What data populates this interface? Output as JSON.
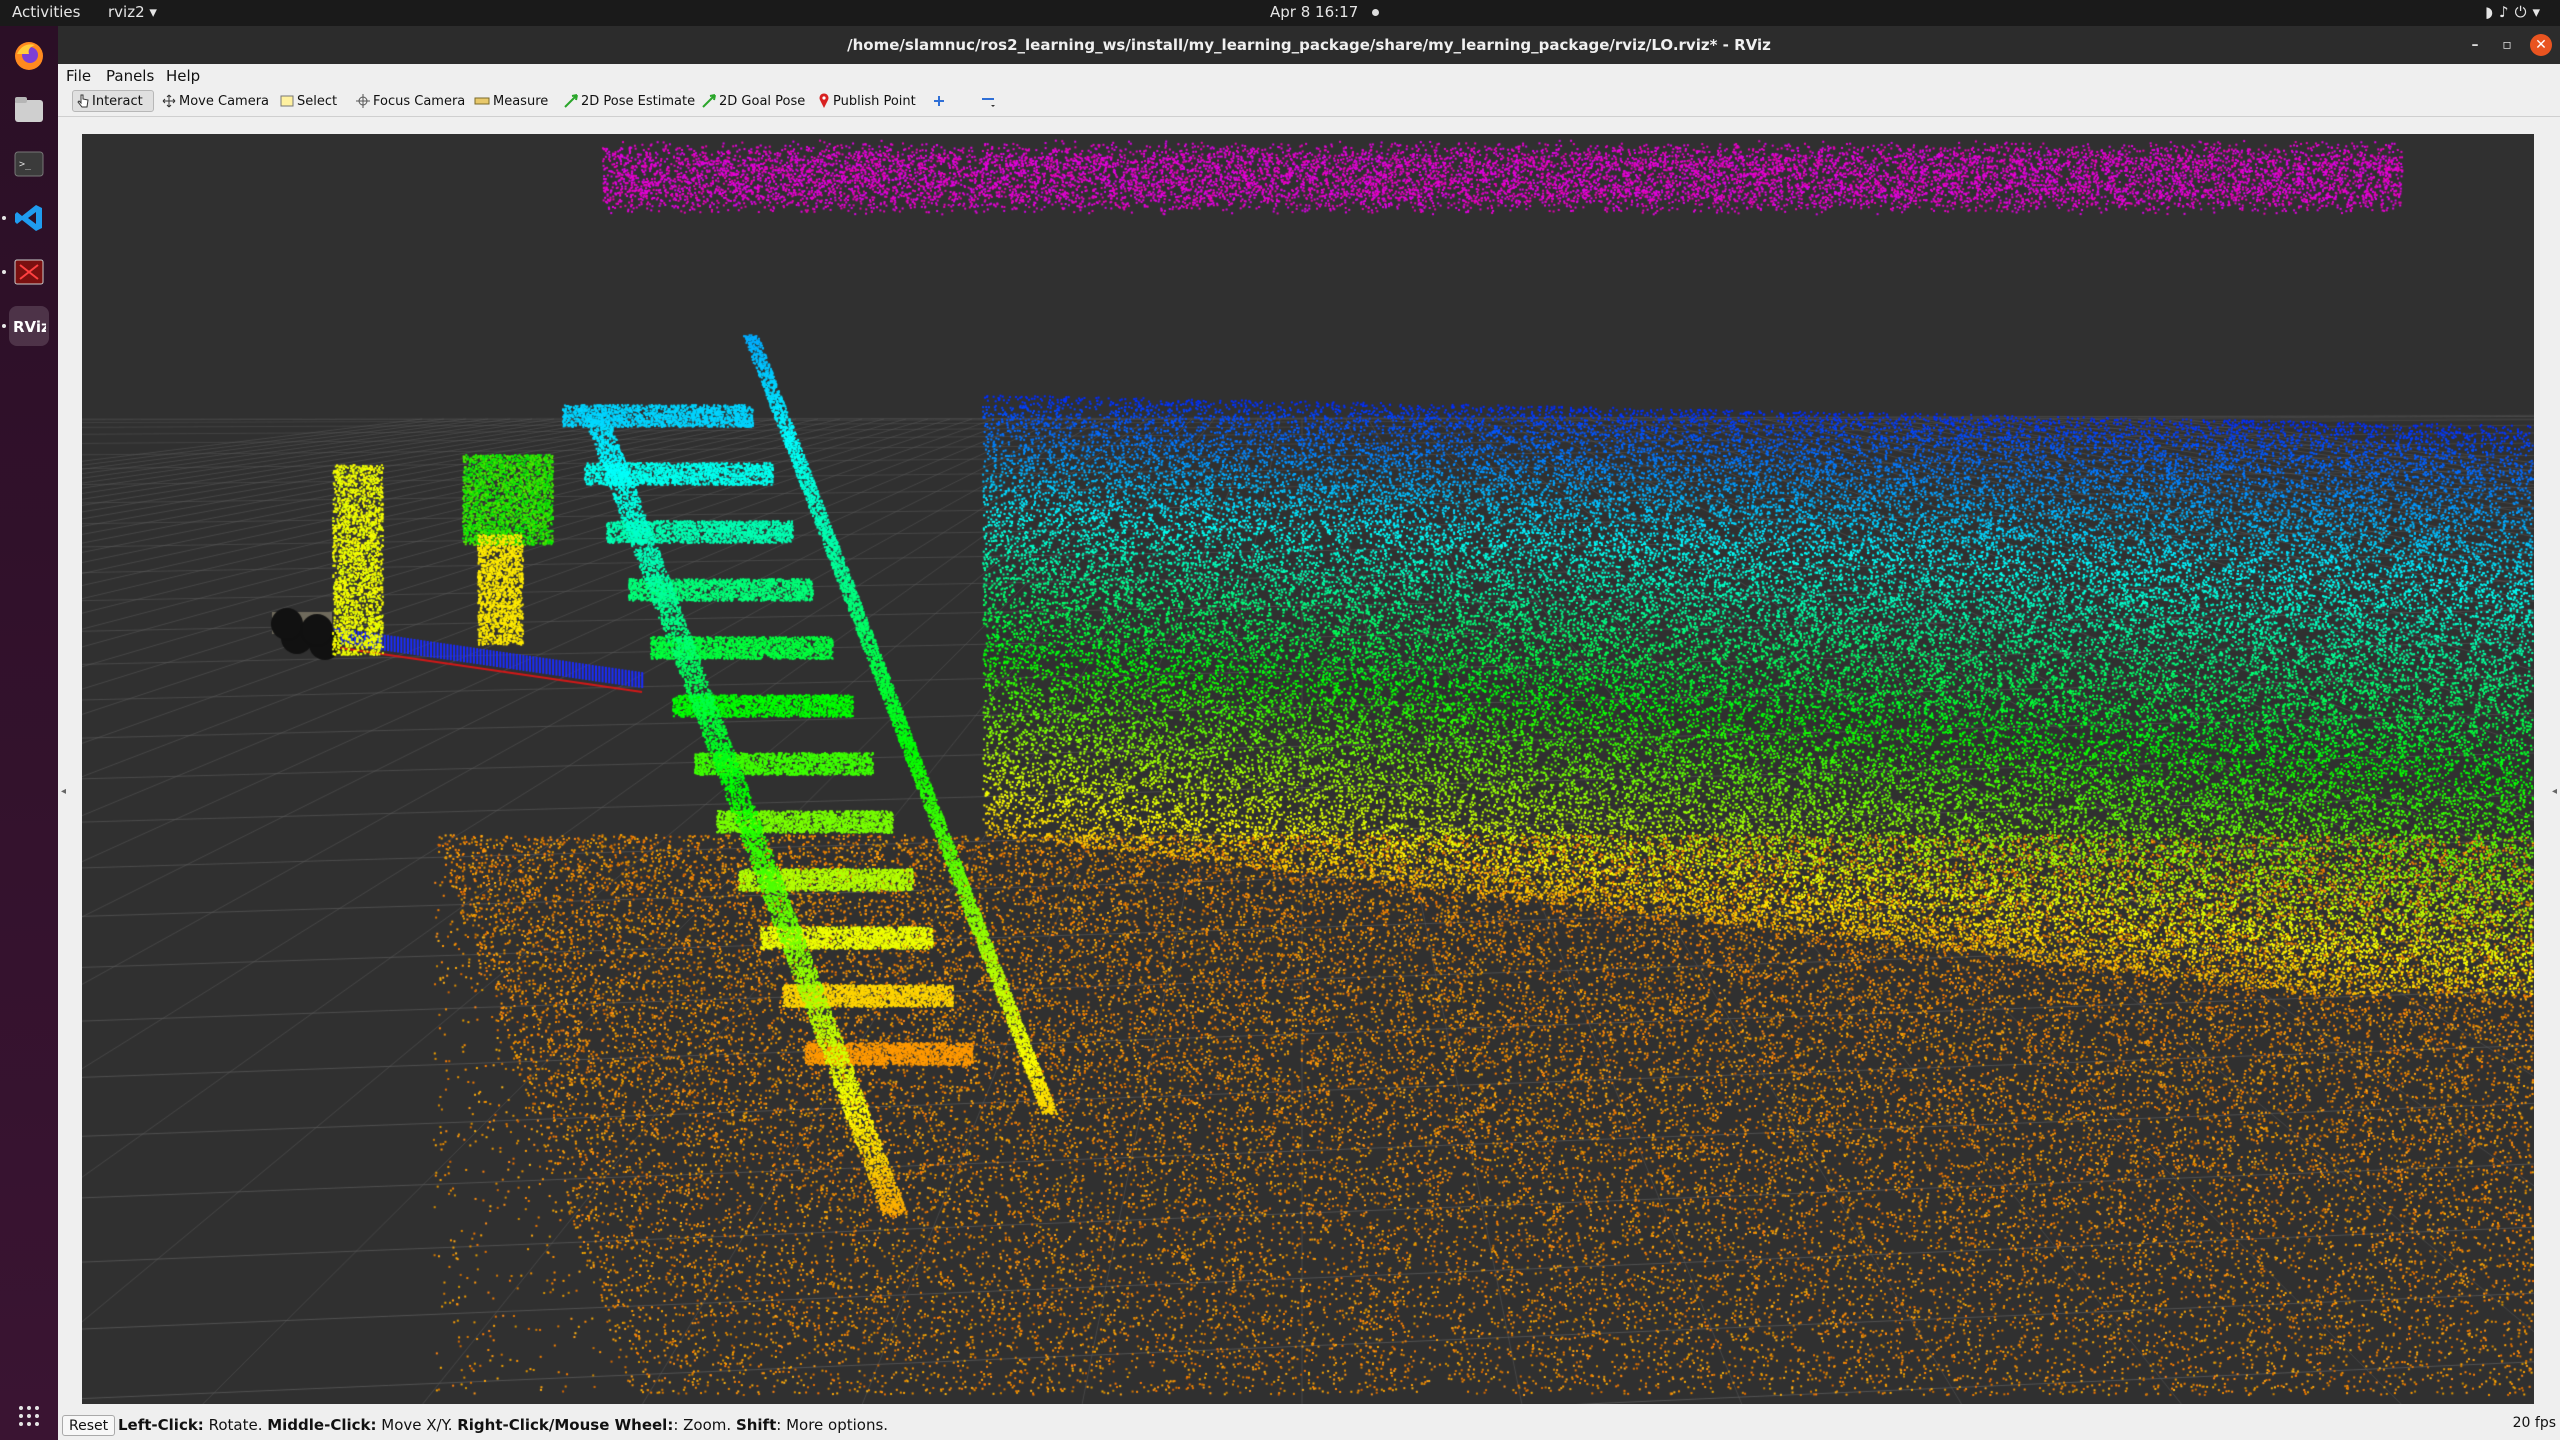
{
  "topbar": {
    "activities": "Activities",
    "app_menu": "rviz2 ▾",
    "clock": "Apr 8  16:17"
  },
  "dock": {
    "icons": [
      "firefox-icon",
      "files-icon",
      "terminal-icon",
      "vscode-icon",
      "rqt-icon",
      "rviz-icon",
      "show-apps-icon"
    ]
  },
  "window": {
    "title": "/home/slamnuc/ros2_learning_ws/install/my_learning_package/share/my_learning_package/rviz/LO.rviz* - RViz",
    "minimize": "–",
    "maximize": "▫",
    "close": "✕"
  },
  "menubar": {
    "file": "File",
    "panels": "Panels",
    "help": "Help"
  },
  "toolbar": {
    "interact": "Interact",
    "move_camera": "Move Camera",
    "select": "Select",
    "focus_camera": "Focus Camera",
    "measure": "Measure",
    "pose_estimate": "2D Pose Estimate",
    "goal_pose": "2D Goal Pose",
    "publish_point": "Publish Point"
  },
  "status": {
    "reset": "Reset",
    "left_key": "Left-Click:",
    "left_val": " Rotate. ",
    "middle_key": "Middle-Click:",
    "middle_val": " Move X/Y. ",
    "right_key": "Right-Click/Mouse Wheel:",
    "right_val": ": Zoom. ",
    "shift_key": "Shift",
    "shift_val": ": More options.",
    "fps": "20 fps"
  },
  "colors": {
    "accent": "#e95420",
    "viewport_bg": "#303030",
    "grid": "#5e5e5e",
    "path_blue": "#1a2cff",
    "path_red": "#d21818"
  }
}
